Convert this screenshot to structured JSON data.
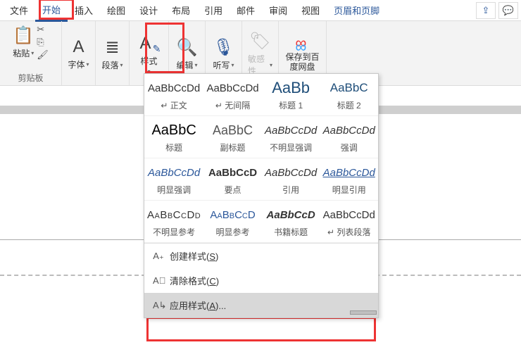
{
  "menu": {
    "file": "文件",
    "home": "开始",
    "insert": "插入",
    "draw": "绘图",
    "design": "设计",
    "layout": "布局",
    "references": "引用",
    "mailings": "邮件",
    "review": "审阅",
    "view": "视图",
    "headerfooter": "页眉和页脚"
  },
  "ribbon": {
    "paste": "粘贴",
    "clipboard": "剪贴板",
    "font": "字体",
    "paragraph": "段落",
    "styles": "样式",
    "editing": "编辑",
    "dictate": "听写",
    "sensitivity": "敏感性",
    "baidu": "保存到百度网盘"
  },
  "styles": {
    "items": [
      {
        "preview": "AaBbCcDd",
        "caption": "正文",
        "cls": ""
      },
      {
        "preview": "AaBbCcDd",
        "caption": "无间隔",
        "cls": ""
      },
      {
        "preview": "AaBb",
        "caption": "标题 1",
        "cls": "big"
      },
      {
        "preview": "AaBbC",
        "caption": "标题 2",
        "cls": "h2"
      },
      {
        "preview": "AaBbC",
        "caption": "标题",
        "cls": "title"
      },
      {
        "preview": "AaBbC",
        "caption": "副标题",
        "cls": "sub"
      },
      {
        "preview": "AaBbCcDd",
        "caption": "不明显强调",
        "cls": "italic"
      },
      {
        "preview": "AaBbCcDd",
        "caption": "强调",
        "cls": "italic"
      },
      {
        "preview": "AaBbCcDd",
        "caption": "明显强调",
        "cls": "blueital"
      },
      {
        "preview": "AaBbCcD",
        "caption": "要点",
        "cls": "bold"
      },
      {
        "preview": "AaBbCcDd",
        "caption": "引用",
        "cls": "italic"
      },
      {
        "preview": "AaBbCcDd",
        "caption": "明显引用",
        "cls": "bluelink"
      },
      {
        "preview": "AaBbCcDd",
        "caption": "不明显参考",
        "cls": "smallcaps"
      },
      {
        "preview": "AaBbCcD",
        "caption": "明显参考",
        "cls": "bluecaps"
      },
      {
        "preview": "AaBbCcD",
        "caption": "书籍标题",
        "cls": "bolditalic"
      },
      {
        "preview": "AaBbCcDd",
        "caption": "列表段落",
        "cls": ""
      }
    ],
    "create": "创建样式",
    "createKey": "S",
    "clear": "清除格式",
    "clearKey": "C",
    "apply": "应用样式",
    "applyKey": "A",
    "applyDots": "..."
  }
}
